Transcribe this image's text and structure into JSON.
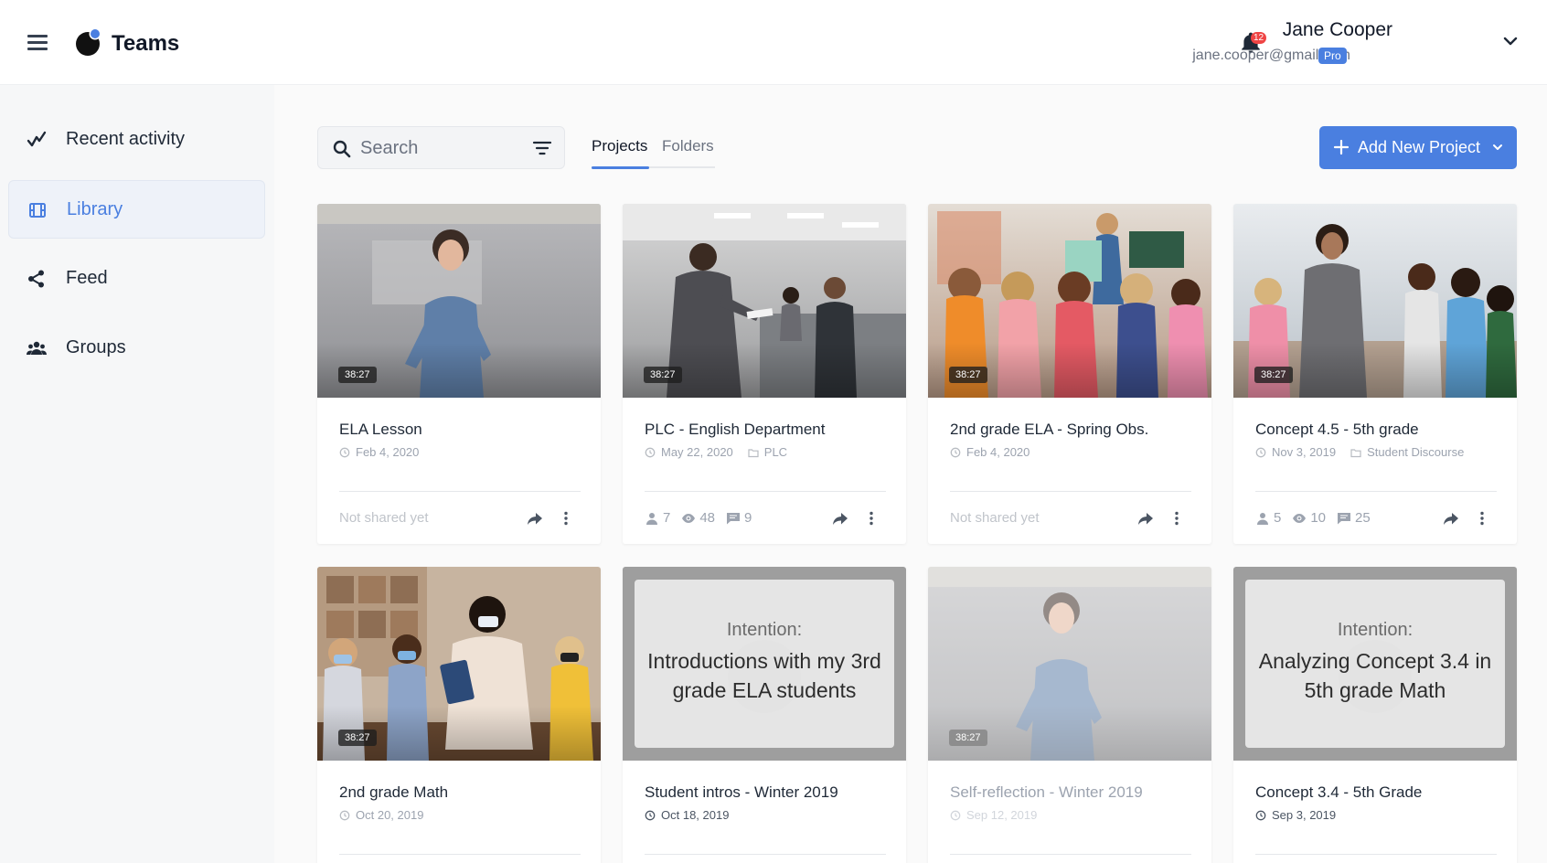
{
  "header": {
    "app_title": "Teams",
    "notification_count": "12",
    "user_name": "Jane Cooper",
    "user_email": "jane.cooper@gmail.com",
    "plan_badge": "Pro"
  },
  "sidebar": {
    "items": [
      {
        "label": "Recent activity",
        "icon": "activity-check-icon",
        "active": false
      },
      {
        "label": "Library",
        "icon": "film-library-icon",
        "active": true
      },
      {
        "label": "Feed",
        "icon": "share-nodes-icon",
        "active": false
      },
      {
        "label": "Groups",
        "icon": "users-group-icon",
        "active": false
      }
    ]
  },
  "toolbar": {
    "search_placeholder": "Search",
    "tabs": [
      {
        "label": "Projects",
        "active": true
      },
      {
        "label": "Folders",
        "active": false
      }
    ],
    "add_button_label": "Add New Project"
  },
  "colors": {
    "accent": "#4a7fe0",
    "badge_red": "#ef4444"
  },
  "cards": [
    {
      "title": "ELA Lesson",
      "date": "Feb 4, 2020",
      "folder": "",
      "duration": "38:27",
      "shared": false,
      "status_text": "Not shared yet",
      "stats": null
    },
    {
      "title": "PLC - English Department",
      "date": "May 22, 2020",
      "folder": "PLC",
      "duration": "38:27",
      "shared": true,
      "status_text": "",
      "stats": {
        "viewers": "7",
        "views": "48",
        "comments": "9"
      }
    },
    {
      "title": "2nd grade ELA - Spring Obs.",
      "date": "Feb 4, 2020",
      "folder": "",
      "duration": "38:27",
      "shared": false,
      "status_text": "Not shared yet",
      "stats": null
    },
    {
      "title": "Concept 4.5 - 5th grade",
      "date": "Nov 3, 2019",
      "folder": "Student Discourse",
      "duration": "38:27",
      "shared": true,
      "status_text": "",
      "stats": {
        "viewers": "5",
        "views": "10",
        "comments": "25"
      }
    },
    {
      "title": "2nd grade Math",
      "date": "Oct 20, 2019",
      "folder": "",
      "duration": "38:27",
      "intention": null
    },
    {
      "title": "Student intros - Winter 2019",
      "date": "Oct 18, 2019",
      "folder": "",
      "duration": "",
      "intention": {
        "label": "Intention:",
        "text": "Introductions with my 3rd grade ELA students"
      }
    },
    {
      "title": "Self-reflection - Winter 2019",
      "date": "Sep 12, 2019",
      "folder": "",
      "duration": "38:27",
      "intention": null
    },
    {
      "title": "Concept 3.4 - 5th Grade",
      "date": "Sep 3, 2019",
      "folder": "",
      "duration": "",
      "intention": {
        "label": "Intention:",
        "text": "Analyzing Concept 3.4 in 5th grade Math"
      }
    }
  ]
}
